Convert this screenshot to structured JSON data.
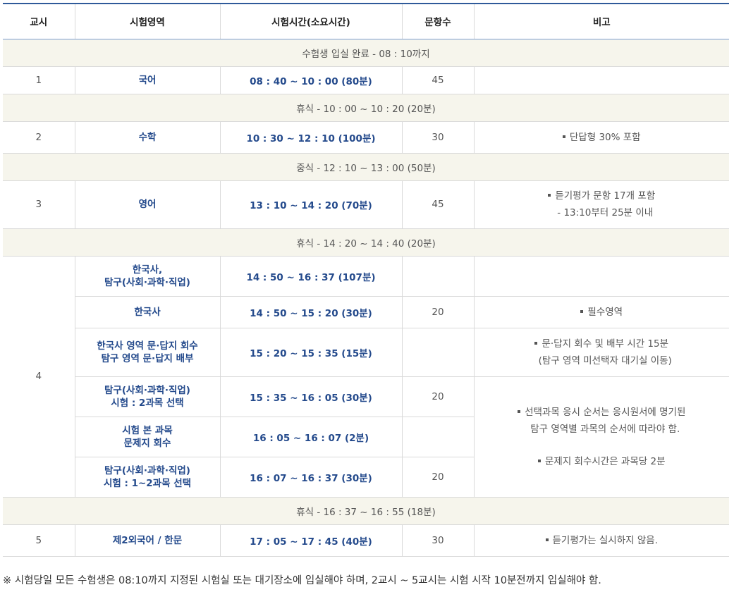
{
  "headers": {
    "period": "교시",
    "area": "시험영역",
    "time": "시험시간(소요시간)",
    "count": "문항수",
    "remark": "비고"
  },
  "entry_row": "수험생 입실 완료 - 08 : 10까지",
  "period1": {
    "period": "1",
    "subject": "국어",
    "time": "08 : 40 ~ 10 : 00 (80분)",
    "count": "45"
  },
  "break1": "휴식 - 10 : 00 ~ 10 : 20 (20분)",
  "period2": {
    "period": "2",
    "subject": "수학",
    "time": "10 : 30 ~ 12 : 10 (100분)",
    "count": "30",
    "remark": "단답형 30% 포함"
  },
  "lunch": "중식 - 12 : 10 ~ 13 : 00 (50분)",
  "period3": {
    "period": "3",
    "subject": "영어",
    "time": "13 : 10 ~ 14 : 20 (70분)",
    "count": "45",
    "remark_line1": "듣기평가 문항 17개 포함",
    "remark_line2": "- 13:10부터 25분 이내"
  },
  "break2": "휴식 - 14 : 20 ~ 14 : 40 (20분)",
  "period4": {
    "period": "4",
    "rows": [
      {
        "subject_line1": "한국사,",
        "subject_line2": "탐구(사회·과학·직업)",
        "time": "14 : 50 ~ 16 : 37 (107분)",
        "count": ""
      },
      {
        "subject_line1": "한국사",
        "time": "14 : 50 ~ 15 : 20 (30분)",
        "count": "20",
        "remark": "필수영역"
      },
      {
        "subject_line1": "한국사 영역 문·답지 회수",
        "subject_line2": "탐구 영역 문·답지 배부",
        "time": "15 : 20 ~ 15 : 35 (15분)",
        "count": "",
        "remark_line1": "문·답지 회수 및 배부 시간 15분",
        "remark_line2": "(탐구 영역 미선택자 대기실 이동)"
      },
      {
        "subject_line1": "탐구(사회·과학·직업)",
        "subject_line2": "시험 : 2과목 선택",
        "time": "15 : 35 ~ 16 : 05 (30분)",
        "count": "20"
      },
      {
        "subject_line1": "시험 본 과목",
        "subject_line2": "문제지 회수",
        "time": "16 : 05 ~ 16 : 07 (2분)",
        "count": ""
      },
      {
        "subject_line1": "탐구(사회·과학·직업)",
        "subject_line2": "시험 : 1~2과목 선택",
        "time": "16 : 07 ~ 16 : 37 (30분)",
        "count": "20"
      }
    ],
    "merged_remark_line1": "선택과목 응시 순서는 응시원서에 명기된",
    "merged_remark_line2": "탐구 영역별 과목의 순서에 따라야 함.",
    "merged_remark_line3": "문제지 회수시간은 과목당 2분"
  },
  "break3": "휴식 - 16 : 37 ~ 16 : 55 (18분)",
  "period5": {
    "period": "5",
    "subject": "제2외국어 / 한문",
    "time": "17 : 05 ~ 17 : 45 (40분)",
    "count": "30",
    "remark": "듣기평가는 실시하지 않음."
  },
  "footnote": "※ 시험당일 모든 수험생은 08:10까지 지정된 시험실 또는 대기장소에 입실해야 하며, 2교시 ~ 5교시는 시험 시작 10분전까지 입실해야 함."
}
